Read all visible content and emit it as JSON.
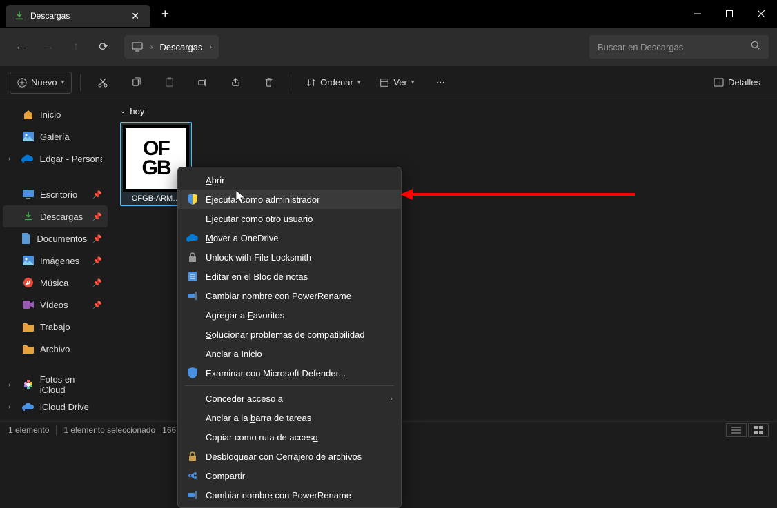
{
  "titlebar": {
    "tab_title": "Descargas"
  },
  "navbar": {
    "breadcrumb": "Descargas",
    "search_placeholder": "Buscar en Descargas"
  },
  "toolbar": {
    "new": "Nuevo",
    "sort": "Ordenar",
    "view": "Ver",
    "details": "Detalles"
  },
  "sidebar": {
    "home": "Inicio",
    "gallery": "Galería",
    "personal": "Edgar - Persona",
    "desktop": "Escritorio",
    "downloads": "Descargas",
    "documents": "Documentos",
    "images": "Imágenes",
    "music": "Música",
    "videos": "Vídeos",
    "work": "Trabajo",
    "archive": "Archivo",
    "icloud_photos": "Fotos en iCloud",
    "icloud_drive": "iCloud Drive"
  },
  "content": {
    "group": "hoy",
    "file_thumb_text": "OF\nGB",
    "file_name": "OFGB-ARM…"
  },
  "context_menu": {
    "open": "Abrir",
    "run_admin": "Ejecutar como administrador",
    "run_other": "Ejecutar como otro usuario",
    "move_onedrive": "Mover a OneDrive",
    "unlock": "Unlock with File Locksmith",
    "edit_notepad": "Editar en el Bloc de notas",
    "powerrename": "Cambiar nombre con PowerRename",
    "add_fav": "Agregar a Favoritos",
    "compat": "Solucionar problemas de compatibilidad",
    "pin_start": "Anclar a Inicio",
    "defender": "Examinar con Microsoft Defender...",
    "grant": "Conceder acceso a",
    "pin_taskbar": "Anclar a la barra de tareas",
    "copy_path": "Copiar como ruta de acceso",
    "unlock_locksmith": "Desbloquear con Cerrajero de archivos",
    "share": "Compartir",
    "powerrename2": "Cambiar nombre con PowerRename"
  },
  "statusbar": {
    "count": "1 elemento",
    "selected": "1 elemento seleccionado",
    "size": "166"
  }
}
